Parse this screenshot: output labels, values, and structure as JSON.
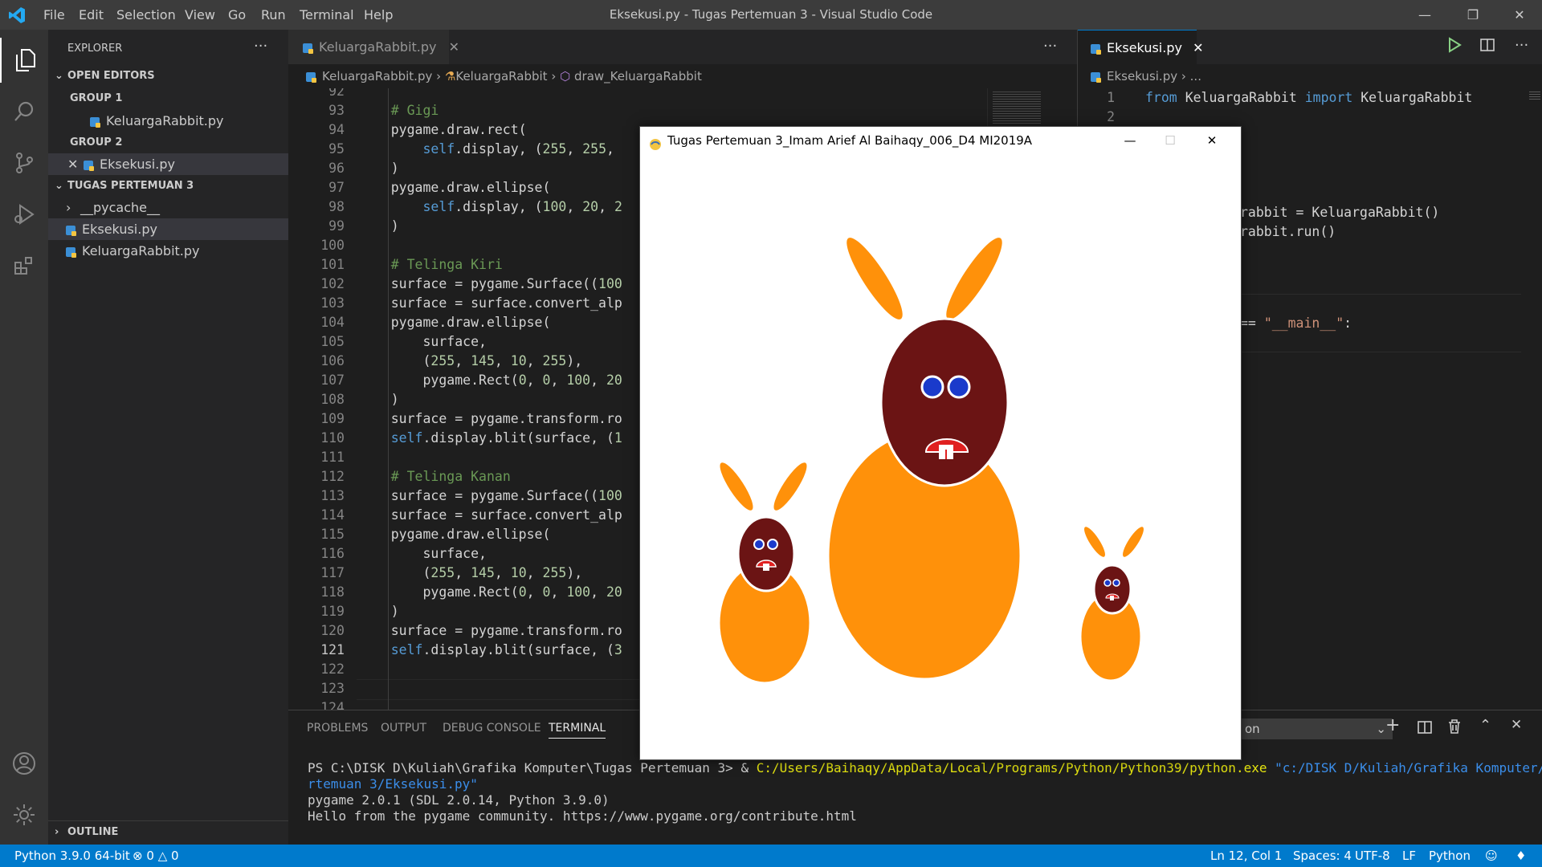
{
  "titlebar": {
    "menu": [
      "File",
      "Edit",
      "Selection",
      "View",
      "Go",
      "Run",
      "Terminal",
      "Help"
    ],
    "window_title": "Eksekusi.py - Tugas Pertemuan 3 - Visual Studio Code"
  },
  "sidebar": {
    "header": "EXPLORER",
    "open_editors": "OPEN EDITORS",
    "group1": "GROUP 1",
    "group1_file": "KeluargaRabbit.py",
    "group2": "GROUP 2",
    "group2_file": "Eksekusi.py",
    "folder": "TUGAS PERTEMUAN 3",
    "items": [
      "__pycache__",
      "Eksekusi.py",
      "KeluargaRabbit.py"
    ],
    "outline": "OUTLINE"
  },
  "editor1": {
    "tab": "KeluargaRabbit.py",
    "breadcrumb": [
      "KeluargaRabbit.py",
      "KeluargaRabbit",
      "draw_KeluargaRabbit"
    ],
    "current_line": "121"
  },
  "editor2": {
    "tab": "Eksekusi.py",
    "breadcrumb": [
      "Eksekusi.py",
      "..."
    ],
    "line1_from": "from",
    "line1_mod": "KeluargaRabbit",
    "line1_import": "import",
    "line1_cls": "KeluargaRabbit",
    "line_a": "rabbit = KeluargaRabbit()",
    "line_b": "rabbit.run()",
    "line_c_pre": "== ",
    "line_c_str": "\"__main__\"",
    "line_c_post": ":"
  },
  "panel": {
    "tabs": [
      "PROBLEMS",
      "OUTPUT",
      "DEBUG CONSOLE",
      "TERMINAL"
    ],
    "dropdown": "on",
    "terminal": {
      "prompt": "PS C:\\DISK D\\Kuliah\\Grafika Komputer\\Tugas Pertemuan 3> & ",
      "exe": "C:/Users/Baihaqy/AppData/Local/Programs/Python/Python39/python.exe",
      "arg1": " \"c:/DISK D/Kuliah/Grafika Komputer/Tugas Pe",
      "arg2": "rtemuan 3/Eksekusi.py\"",
      "line2": "pygame 2.0.1 (SDL 2.0.14, Python 3.9.0)",
      "line3": "Hello from the pygame community. https://www.pygame.org/contribute.html"
    }
  },
  "statusbar": {
    "interpreter": "Python 3.9.0 64-bit",
    "errors": "0",
    "warnings": "0",
    "position": "Ln 12, Col 1",
    "spaces": "Spaces: 4",
    "encoding": "UTF-8",
    "eol": "LF",
    "language": "Python"
  },
  "pygame_window": {
    "title": "Tugas Pertemuan 3_Imam Arief Al Baihaqy_006_D4 MI2019A"
  },
  "colors": {
    "accent": "#007acc",
    "rabbit_body": "#ff910a",
    "rabbit_head": "#6b1414",
    "eyes": "#1a3acb",
    "mouth": "#e02020"
  }
}
